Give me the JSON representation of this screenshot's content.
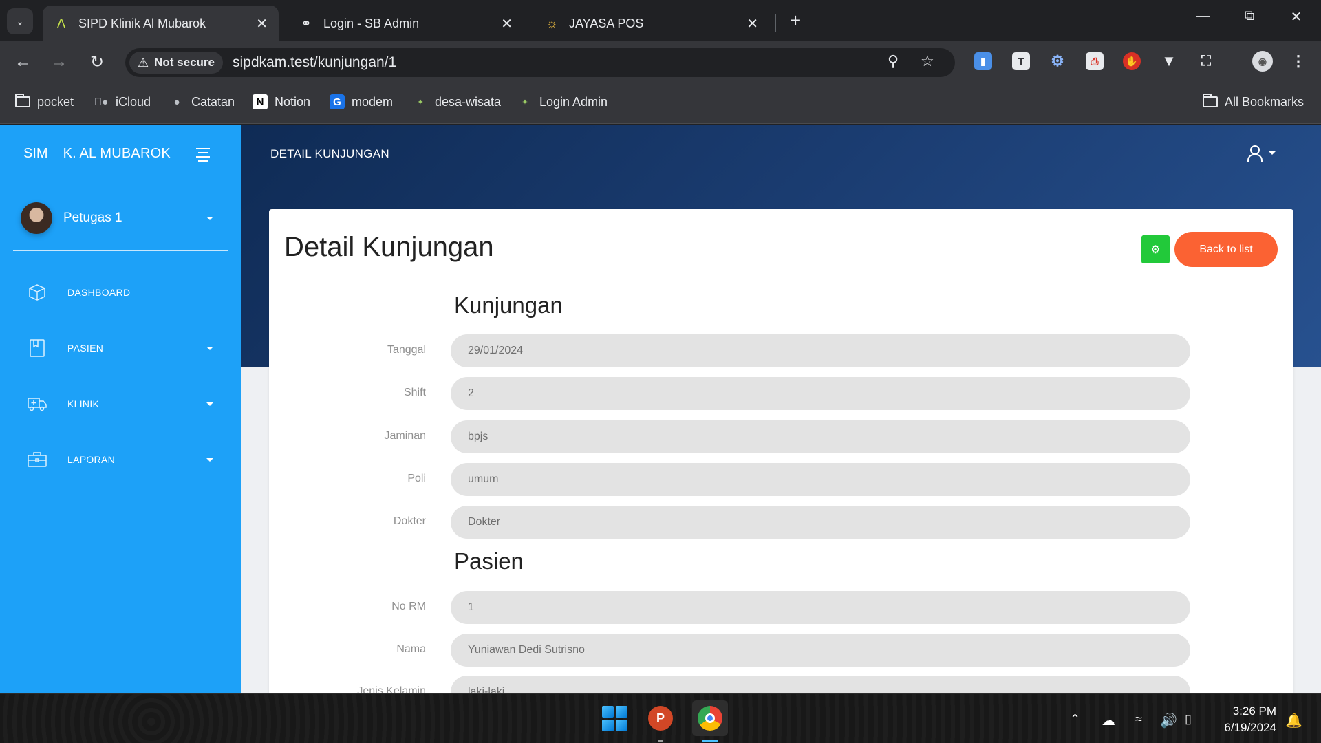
{
  "browser": {
    "tabs": [
      {
        "title": "SIPD Klinik Al Mubarok",
        "favicon": "sipd-favicon",
        "active": true
      },
      {
        "title": "Login - SB Admin",
        "favicon": "globe-icon",
        "active": false
      },
      {
        "title": "JAYASA POS",
        "favicon": "jayasa-favicon",
        "active": false
      }
    ],
    "security_label": "Not secure",
    "url": "sipdkam.test/kunjungan/1",
    "bookmarks": [
      {
        "label": "pocket",
        "icon": "folder-icon"
      },
      {
        "label": "iCloud",
        "icon": "apple-icon"
      },
      {
        "label": "Catatan",
        "icon": "apple-icon"
      },
      {
        "label": "Notion",
        "icon": "notion-icon"
      },
      {
        "label": "modem",
        "icon": "modem-icon"
      },
      {
        "label": "desa-wisata",
        "icon": "leaf-icon"
      },
      {
        "label": "Login Admin",
        "icon": "leaf-icon"
      }
    ],
    "all_bookmarks_label": "All Bookmarks"
  },
  "sidebar": {
    "brand_mini": "SIM",
    "brand_full": "K. AL MUBAROK",
    "user_name": "Petugas 1",
    "menu": [
      {
        "label": "DASHBOARD",
        "icon": "cube-icon",
        "has_caret": false
      },
      {
        "label": "PASIEN",
        "icon": "book-icon",
        "has_caret": true
      },
      {
        "label": "KLINIK",
        "icon": "ambulance-icon",
        "has_caret": true
      },
      {
        "label": "LAPORAN",
        "icon": "briefcase-icon",
        "has_caret": true
      }
    ]
  },
  "header": {
    "page_heading": "DETAIL KUNJUNGAN"
  },
  "card": {
    "title": "Detail Kunjungan",
    "back_label": "Back to list",
    "sections": [
      {
        "title": "Kunjungan",
        "fields": [
          {
            "label": "Tanggal",
            "value": "29/01/2024"
          },
          {
            "label": "Shift",
            "value": "2"
          },
          {
            "label": "Jaminan",
            "value": "bpjs"
          },
          {
            "label": "Poli",
            "value": "umum"
          },
          {
            "label": "Dokter",
            "value": "Dokter"
          }
        ]
      },
      {
        "title": "Pasien",
        "fields": [
          {
            "label": "No RM",
            "value": "1"
          },
          {
            "label": "Nama",
            "value": "Yuniawan Dedi Sutrisno"
          },
          {
            "label": "Jenis Kelamin",
            "value": "laki-laki"
          }
        ]
      }
    ]
  },
  "taskbar": {
    "time": "3:26 PM",
    "date": "6/19/2024"
  },
  "colors": {
    "sidebar": "#1da1f8",
    "header_dark": "#0f2b55",
    "back_button": "#fb6233",
    "print_button": "#22c93a",
    "input_bg": "#e3e3e3"
  }
}
